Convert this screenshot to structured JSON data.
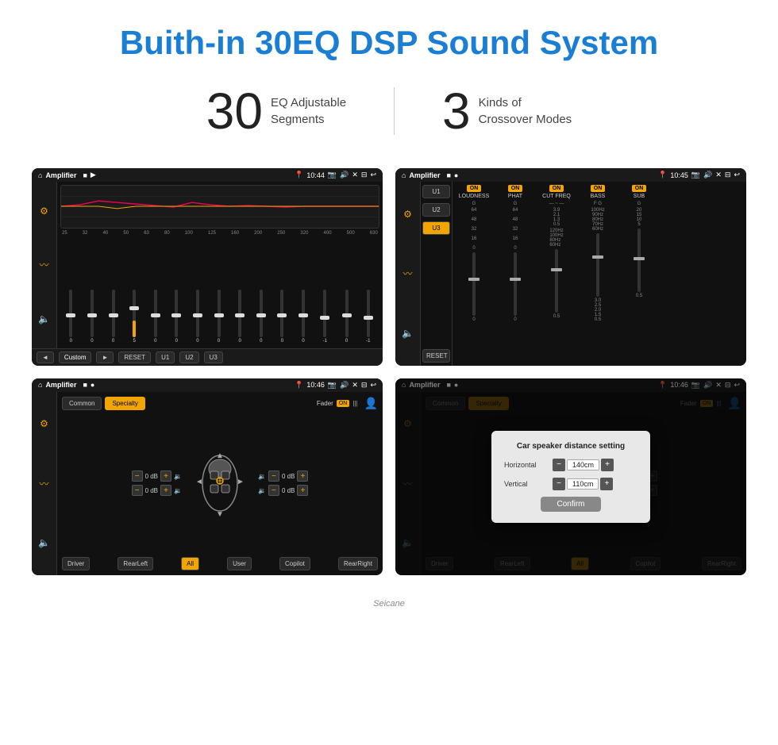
{
  "page": {
    "title": "Buith-in 30EQ DSP Sound System",
    "watermark": "Seicane"
  },
  "stats": {
    "eq": {
      "number": "30",
      "label_line1": "EQ Adjustable",
      "label_line2": "Segments"
    },
    "crossover": {
      "number": "3",
      "label_line1": "Kinds of",
      "label_line2": "Crossover Modes"
    }
  },
  "screens": {
    "top_left": {
      "status_bar": {
        "home": "⌂",
        "app_name": "Amplifier",
        "time": "10:44",
        "icons": [
          "📷",
          "🔊",
          "✕",
          "⊟",
          "↩"
        ]
      },
      "freq_labels": [
        "25",
        "32",
        "40",
        "50",
        "63",
        "80",
        "100",
        "125",
        "160",
        "200",
        "250",
        "320",
        "400",
        "500",
        "630"
      ],
      "slider_values": [
        "0",
        "0",
        "0",
        "5",
        "0",
        "0",
        "0",
        "0",
        "0",
        "0",
        "0",
        "0",
        "-1",
        "0",
        "-1"
      ],
      "bottom_buttons": [
        "◄",
        "Custom",
        "►",
        "RESET",
        "U1",
        "U2",
        "U3"
      ]
    },
    "top_right": {
      "status_bar": {
        "home": "⌂",
        "app_name": "Amplifier",
        "time": "10:45"
      },
      "u_buttons": [
        "U1",
        "U2",
        "U3"
      ],
      "u_active": "U3",
      "channels": [
        {
          "on": true,
          "name": "LOUDNESS",
          "label_g": "G"
        },
        {
          "on": true,
          "name": "PHAT",
          "label_g": "G"
        },
        {
          "on": true,
          "name": "CUT FREQ",
          "label_g": "G"
        },
        {
          "on": true,
          "name": "BASS",
          "label_g": "G"
        },
        {
          "on": true,
          "name": "SUB",
          "label_g": "G"
        }
      ],
      "bottom_buttons": [
        "RESET"
      ]
    },
    "bottom_left": {
      "status_bar": {
        "home": "⌂",
        "app_name": "Amplifier",
        "time": "10:46"
      },
      "top_buttons": [
        "Common",
        "Specialty"
      ],
      "active_tab": "Specialty",
      "fader_label": "Fader",
      "fader_on": "ON",
      "vol_labels": [
        "0 dB",
        "0 dB",
        "0 dB",
        "0 dB"
      ],
      "bottom_buttons": [
        "Driver",
        "RearLeft",
        "All",
        "User",
        "Copilot",
        "RearRight"
      ]
    },
    "bottom_right": {
      "status_bar": {
        "home": "⌂",
        "app_name": "Amplifier",
        "time": "10:46"
      },
      "dialog": {
        "title": "Car speaker distance setting",
        "horizontal_label": "Horizontal",
        "horizontal_value": "140cm",
        "vertical_label": "Vertical",
        "vertical_value": "110cm",
        "confirm_label": "Confirm"
      },
      "bottom_buttons": [
        "Driver",
        "RearLeft",
        "All",
        "Copilot",
        "RearRight"
      ]
    }
  }
}
